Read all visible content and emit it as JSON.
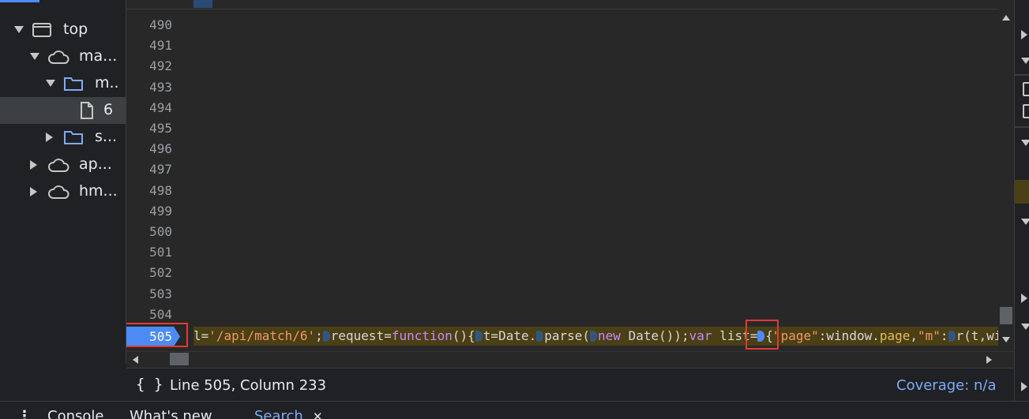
{
  "tree": {
    "items": [
      {
        "label": "top",
        "icon": "frame-icon",
        "expand": "down",
        "indent": 1
      },
      {
        "label": "ma...",
        "icon": "cloud-icon",
        "expand": "down",
        "indent": 2
      },
      {
        "label": "m..",
        "icon": "folder-icon",
        "expand": "down",
        "indent": 3
      },
      {
        "label": "6",
        "icon": "file-icon",
        "expand": "none",
        "indent": 4,
        "selected": true
      },
      {
        "label": "s...",
        "icon": "folder-icon",
        "expand": "right",
        "indent": 3
      },
      {
        "label": "ap...",
        "icon": "cloud-icon",
        "expand": "right",
        "indent": 2
      },
      {
        "label": "hm...",
        "icon": "cloud-icon",
        "expand": "right",
        "indent": 2
      }
    ]
  },
  "editor": {
    "line_numbers": [
      "490",
      "491",
      "492",
      "493",
      "494",
      "495",
      "496",
      "497",
      "498",
      "499",
      "500",
      "501",
      "502",
      "503",
      "504"
    ],
    "active_line": "505",
    "code": {
      "t1": "l=",
      "t2": "'/api/match/6'",
      "t3": ";",
      "t4": "request=",
      "t5": "function",
      "t6": "(){",
      "t7": "t=Date.",
      "t8": "parse(",
      "t9": "new",
      "t10": " Date());",
      "t11": "var",
      "t12": " list=",
      "t13": "{",
      "t14": "\"page\"",
      "t15": ":window.",
      "t16": "page",
      "t17": ",",
      "t18": "\"m\"",
      "t19": ":",
      "t20": "r(t,wi"
    }
  },
  "status": {
    "format_icon": "{ }",
    "position": "Line 505, Column 233",
    "coverage": "Coverage: n/a"
  },
  "bottom_tabs": {
    "menu": "⋮",
    "console": "Console",
    "whats_new": "What's new",
    "search": "Search",
    "close": "✕"
  },
  "colors": {
    "accent": "#4c8bf5",
    "highlight_box": "#e53935",
    "line_highlight": "#4a3f15"
  }
}
